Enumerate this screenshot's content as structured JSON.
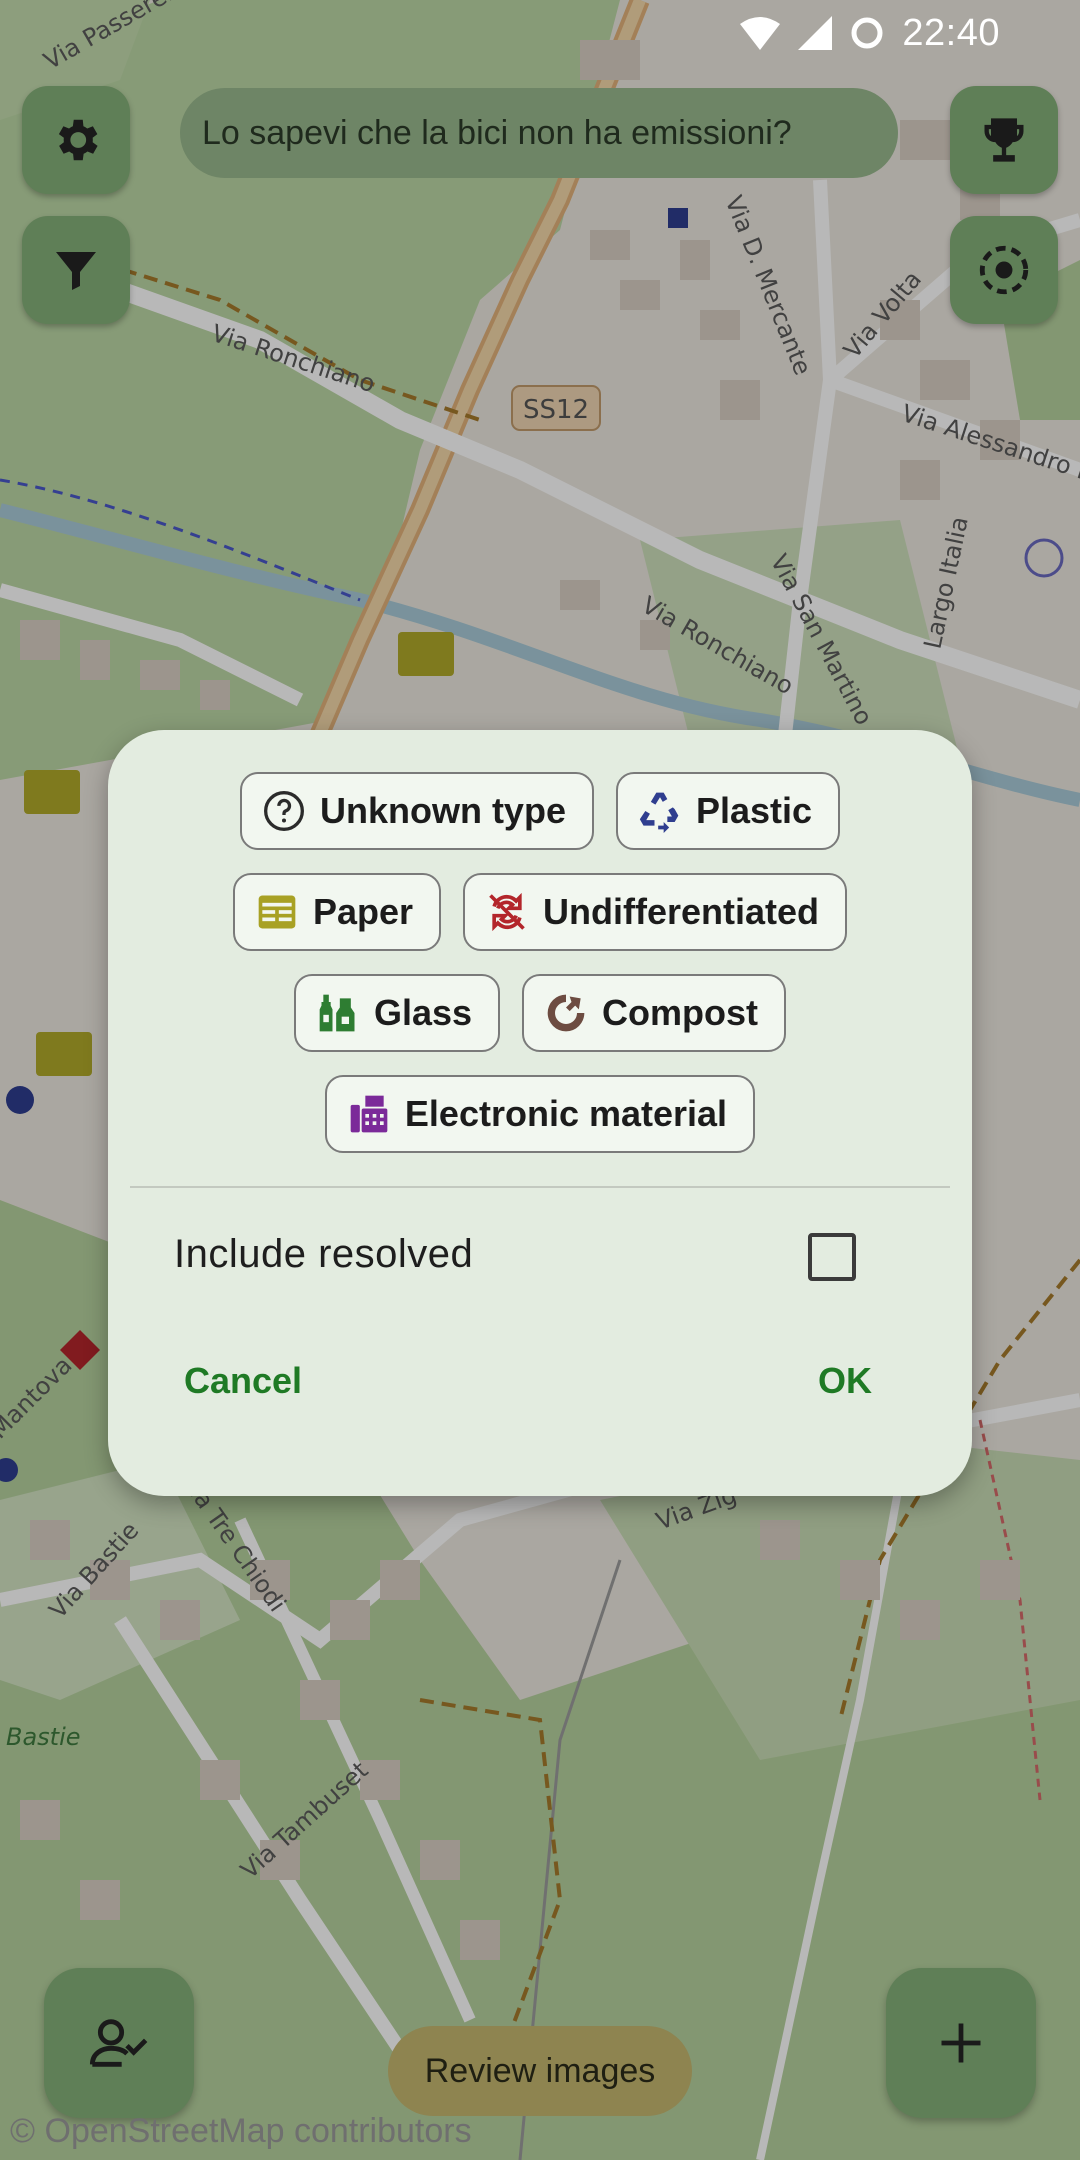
{
  "status_bar": {
    "time": "22:40"
  },
  "map": {
    "labels": {
      "via_ronchiano_1": "Via Ronchiano",
      "via_ronchiano_2": "Via Ronchiano",
      "ss12": "SS12",
      "via_d_mercante": "Via D. Mercante",
      "via_volta": "Via Volta",
      "via_alessandro": "Via Alessandro Mo",
      "via_san_martino": "Via San Martino",
      "largo_italia": "Largo Italia",
      "via_passerella": "Via Passerella",
      "via_bastie": "Via Bastie",
      "via_tre_chiodi": "Via Tre Chiodi",
      "via_tambuset": "Via Tambuset",
      "bastie": "Bastie",
      "mantova": "Mantova",
      "via_zig": "Via Zig"
    },
    "tip_text": "Lo sapevi che la bici non ha emissioni?",
    "review_label": "Review images",
    "attribution": "© OpenStreetMap contributors"
  },
  "colors": {
    "accent_green": "#1f7a25",
    "plastic": "#2f3e8f",
    "paper": "#a8a124",
    "undifferentiated": "#b3262b",
    "glass": "#2e7d32",
    "compost": "#6d4c41",
    "electronic": "#7b2a99"
  },
  "dialog": {
    "chips": [
      {
        "label": "Unknown type",
        "icon": "question-circle-icon"
      },
      {
        "label": "Plastic",
        "icon": "recycle-icon"
      },
      {
        "label": "Paper",
        "icon": "paper-icon"
      },
      {
        "label": "Undifferentiated",
        "icon": "no-recycle-icon"
      },
      {
        "label": "Glass",
        "icon": "bottles-icon"
      },
      {
        "label": "Compost",
        "icon": "compost-icon"
      },
      {
        "label": "Electronic material",
        "icon": "fax-icon"
      }
    ],
    "include_resolved_label": "Include resolved",
    "include_resolved_checked": false,
    "cancel_label": "Cancel",
    "ok_label": "OK"
  }
}
